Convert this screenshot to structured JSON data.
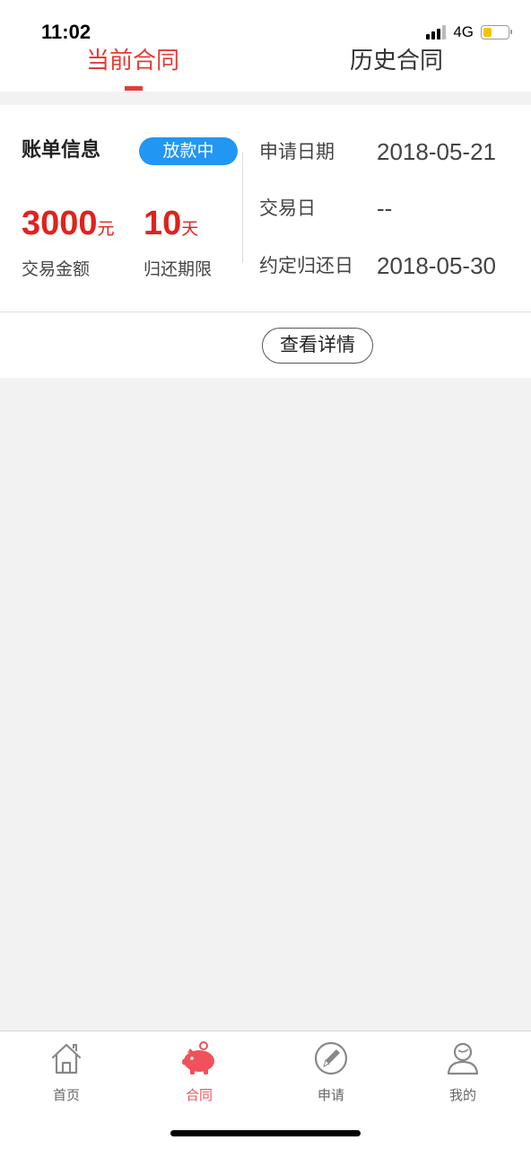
{
  "status_bar": {
    "time": "11:02",
    "network": "4G"
  },
  "tabs": [
    {
      "label": "当前合同",
      "active": true
    },
    {
      "label": "历史合同",
      "active": false
    }
  ],
  "bill": {
    "title": "账单信息",
    "status": "放款中",
    "amount": "3000",
    "amount_unit": "元",
    "amount_label": "交易金额",
    "term": "10",
    "term_unit": "天",
    "term_label": "归还期限",
    "info": [
      {
        "label": "申请日期",
        "value": "2018-05-21"
      },
      {
        "label": "交易日",
        "value": "--"
      },
      {
        "label": "约定归还日",
        "value": "2018-05-30"
      }
    ],
    "detail_button": "查看详情"
  },
  "bottom_nav": [
    {
      "label": "首页",
      "icon": "home-icon",
      "active": false
    },
    {
      "label": "合同",
      "icon": "piggy-bank-icon",
      "active": true
    },
    {
      "label": "申请",
      "icon": "pencil-circle-icon",
      "active": false
    },
    {
      "label": "我的",
      "icon": "user-icon",
      "active": false
    }
  ],
  "colors": {
    "accent": "#e33c36",
    "amount": "#e0221c",
    "badge": "#2196f3",
    "nav_active": "#f0515b"
  }
}
